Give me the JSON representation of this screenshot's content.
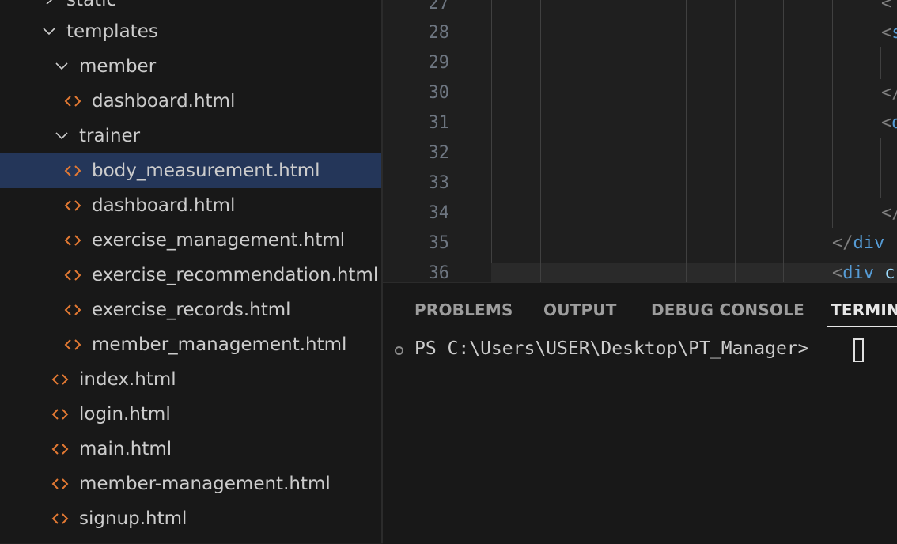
{
  "explorer": {
    "static": {
      "label": "static"
    },
    "templates": {
      "label": "templates"
    },
    "member": {
      "label": "member"
    },
    "member_dashboard": {
      "label": "dashboard.html"
    },
    "trainer": {
      "label": "trainer"
    },
    "body_measurement": {
      "label": "body_measurement.html"
    },
    "trainer_dashboard": {
      "label": "dashboard.html"
    },
    "exercise_management": {
      "label": "exercise_management.html"
    },
    "exercise_recommendation": {
      "label": "exercise_recommendation.html"
    },
    "exercise_records": {
      "label": "exercise_records.html"
    },
    "member_management": {
      "label": "member_management.html"
    },
    "index": {
      "label": "index.html"
    },
    "login": {
      "label": "login.html"
    },
    "main": {
      "label": "main.html"
    },
    "member_management_dash": {
      "label": "member-management.html"
    },
    "signup": {
      "label": "signup.html"
    }
  },
  "editor": {
    "line_numbers": [
      "27",
      "28",
      "29",
      "30",
      "31",
      "32",
      "33",
      "34",
      "35",
      "36"
    ],
    "code": {
      "l27": "<",
      "l28_lt": "<",
      "l28_tag": "s",
      "l30": "</",
      "l31_lt": "<",
      "l31_tag": "d",
      "l34": "</",
      "l35_open": "</",
      "l35_tag": "div",
      "l36_lt": "<",
      "l36_tag": "div",
      "l36_attr": "c"
    }
  },
  "panel": {
    "tabs": [
      "PROBLEMS",
      "OUTPUT",
      "DEBUG CONSOLE",
      "TERMIN"
    ],
    "prompt": "PS C:\\Users\\USER\\Desktop\\PT_Manager> "
  },
  "colors": {
    "file_icon": "#e37933",
    "selection": "#243659",
    "tag": "#569cd6"
  }
}
